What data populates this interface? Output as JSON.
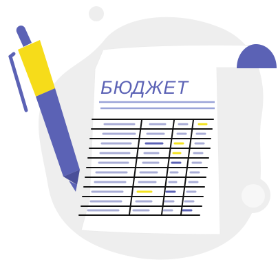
{
  "document": {
    "title": "БЮДЖЕТ"
  },
  "colors": {
    "blob": "#eeeeee",
    "paper": "#ffffff",
    "ink": "#111111",
    "accent": "#5b62b5",
    "highlight": "#f3e21e",
    "dash_light": "#a9add6",
    "dash_dark": "#5b62b5",
    "pen_body": "#5b62b5",
    "pen_grip": "#f6dc1a",
    "pen_tip": "#4a4f99"
  },
  "icons": {
    "pen": "pen-icon",
    "paper": "paper-sheet-icon"
  }
}
